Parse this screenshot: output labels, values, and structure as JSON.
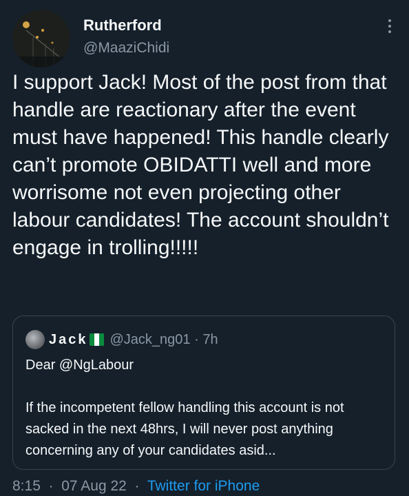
{
  "author": {
    "display_name": "Rutherford",
    "handle": "@MaaziChidi",
    "avatar_icon": "avatar-photo"
  },
  "menu_icon": "more-options-icon",
  "tweet_text": "I support Jack! Most of the post from that handle are reactionary after the event must have happened! This handle clearly can’t promote OBIDATTI well and more worrisome not even projecting other labour candidates! The account shouldn’t engage in trolling!!!!!",
  "quote": {
    "name": "Jack",
    "flag": "nigeria-flag-icon",
    "handle": "@Jack_ng01",
    "separator": "·",
    "time": "7h",
    "line1": "Dear @NgLabour",
    "line2": "If the incompetent fellow handling this account is not sacked in the next 48hrs, I will never post anything concerning any of your candidates asid..."
  },
  "footer": {
    "time": "8:15",
    "sep1": "·",
    "date": "07 Aug 22",
    "sep2": "·",
    "source": "Twitter for iPhone"
  },
  "colors": {
    "background": "#15202b",
    "text": "#f7f9f9",
    "muted": "#8b98a5",
    "link": "#1d9bf0",
    "border": "#38444d"
  }
}
